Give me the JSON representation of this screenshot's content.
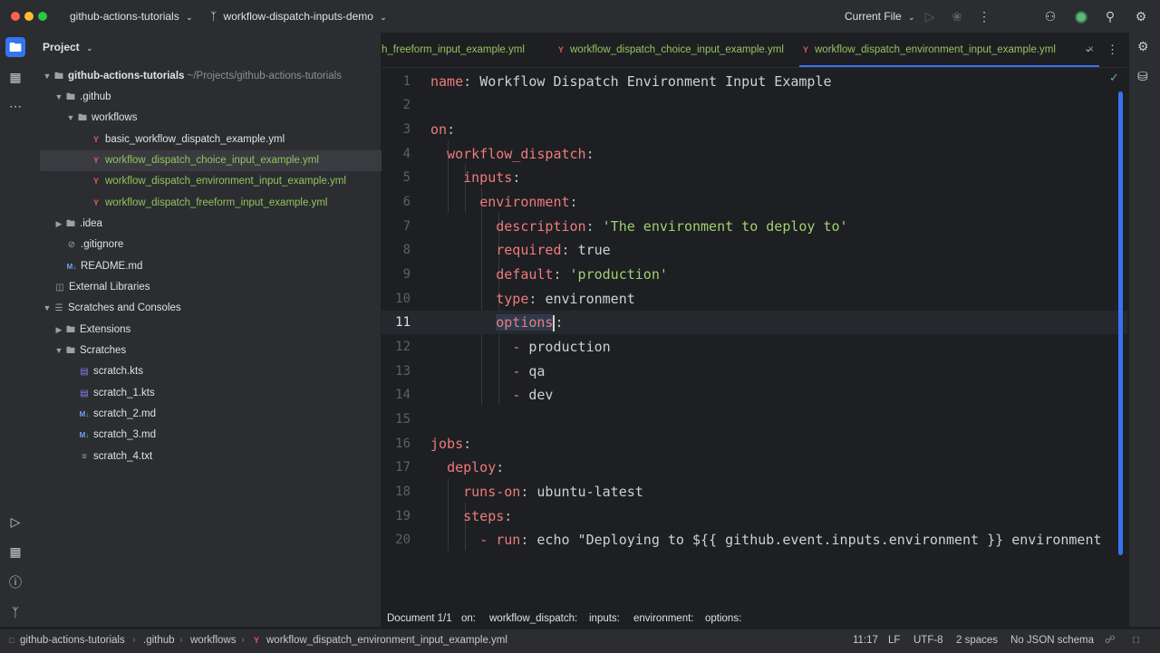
{
  "titlebar": {
    "project_name": "github-actions-tutorials",
    "branch_name": "workflow-dispatch-inputs-demo",
    "run_config": "Current File"
  },
  "sidebar": {
    "header": "Project",
    "tree": {
      "root": "github-actions-tutorials",
      "root_path": "~/Projects/github-actions-tutorials",
      "github": ".github",
      "workflows": "workflows",
      "file1": "basic_workflow_dispatch_example.yml",
      "file2": "workflow_dispatch_choice_input_example.yml",
      "file3": "workflow_dispatch_environment_input_example.yml",
      "file4": "workflow_dispatch_freeform_input_example.yml",
      "idea": ".idea",
      "gitignore": ".gitignore",
      "readme": "README.md",
      "external": "External Libraries",
      "scratches_consoles": "Scratches and Consoles",
      "extensions": "Extensions",
      "scratches": "Scratches",
      "s1": "scratch.kts",
      "s2": "scratch_1.kts",
      "s3": "scratch_2.md",
      "s4": "scratch_3.md",
      "s5": "scratch_4.txt"
    }
  },
  "tabs": {
    "t1": "h_freeform_input_example.yml",
    "t2": "workflow_dispatch_choice_input_example.yml",
    "t3": "workflow_dispatch_environment_input_example.yml"
  },
  "editor": {
    "lines": {
      "l1": {
        "key": "name",
        "val": "Workflow Dispatch Environment Input Example"
      },
      "l3": {
        "key": "on"
      },
      "l4": {
        "key": "workflow_dispatch"
      },
      "l5": {
        "key": "inputs"
      },
      "l6": {
        "key": "environment"
      },
      "l7": {
        "key": "description",
        "val": "'The environment to deploy to'"
      },
      "l8": {
        "key": "required",
        "val": "true"
      },
      "l9": {
        "key": "default",
        "val": "'production'"
      },
      "l10": {
        "key": "type",
        "val": "environment"
      },
      "l11": {
        "key": "options"
      },
      "l12": {
        "val": "production"
      },
      "l13": {
        "val": "qa"
      },
      "l14": {
        "val": "dev"
      },
      "l16": {
        "key": "jobs"
      },
      "l17": {
        "key": "deploy"
      },
      "l18": {
        "key": "runs-on",
        "val": "ubuntu-latest"
      },
      "l19": {
        "key": "steps"
      },
      "l20": {
        "key": "run",
        "val": "echo \"Deploying to ${{ github.event.inputs.environment }} environment"
      }
    },
    "numbers": [
      "1",
      "2",
      "3",
      "4",
      "5",
      "6",
      "7",
      "8",
      "9",
      "10",
      "11",
      "12",
      "13",
      "14",
      "15",
      "16",
      "17",
      "18",
      "19",
      "20"
    ]
  },
  "breadcrumbs": {
    "doc": "Document 1/1",
    "c1": "on:",
    "c2": "workflow_dispatch:",
    "c3": "inputs:",
    "c4": "environment:",
    "c5": "options:"
  },
  "statusbar": {
    "path1": "github-actions-tutorials",
    "path2": ".github",
    "path3": "workflows",
    "path4": "workflow_dispatch_environment_input_example.yml",
    "position": "11:17",
    "line_sep": "LF",
    "encoding": "UTF-8",
    "indent": "2 spaces",
    "schema": "No JSON schema"
  },
  "colors": {
    "accent": "#3574f0",
    "key": "#ed7b7e",
    "string": "#9fd071",
    "yml_icon": "#e55765",
    "modified_file": "#94c45f"
  }
}
